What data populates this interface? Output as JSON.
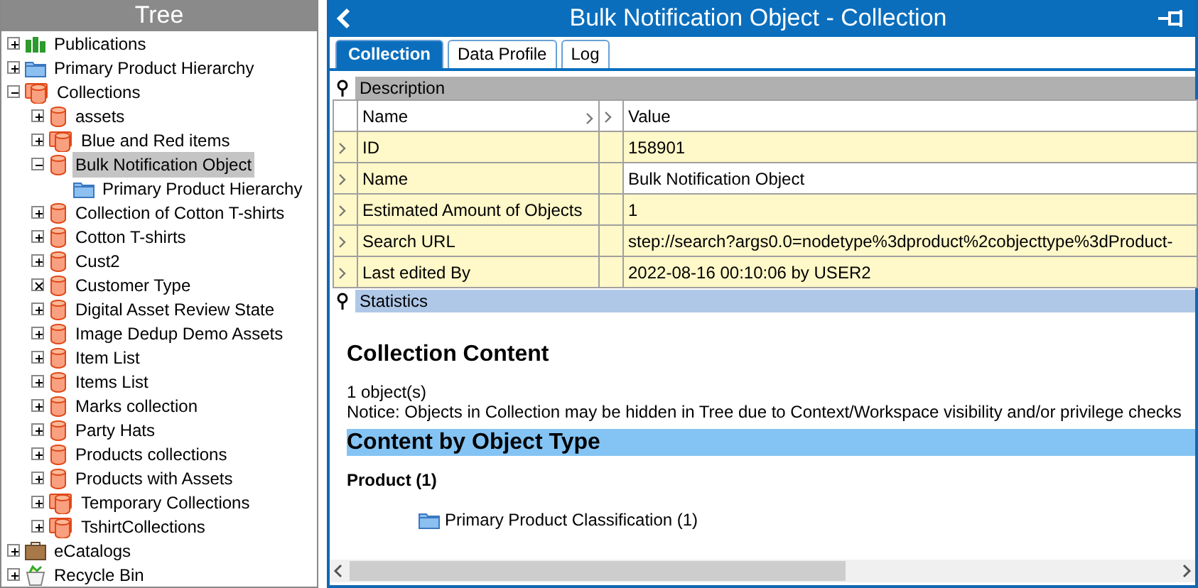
{
  "tree": {
    "title": "Tree",
    "items": [
      {
        "label": "Publications",
        "kind": "publication",
        "expanded": false,
        "empty": false,
        "selected": false
      },
      {
        "label": "Primary Product Hierarchy",
        "kind": "folder",
        "expanded": false,
        "empty": false,
        "selected": false
      },
      {
        "label": "Collections",
        "kind": "collection-group",
        "expanded": true,
        "empty": false,
        "selected": false,
        "children": [
          {
            "label": "assets",
            "kind": "collection",
            "expanded": false,
            "empty": false,
            "selected": false
          },
          {
            "label": "Blue and Red items",
            "kind": "collection-group",
            "expanded": false,
            "empty": false,
            "selected": false
          },
          {
            "label": "Bulk Notification Object",
            "kind": "collection",
            "expanded": true,
            "empty": false,
            "selected": true,
            "children": [
              {
                "label": "Primary Product Hierarchy",
                "kind": "folder",
                "selected": false
              }
            ]
          },
          {
            "label": "Collection of Cotton T-shirts",
            "kind": "collection",
            "expanded": false,
            "empty": false,
            "selected": false
          },
          {
            "label": "Cotton T-shirts",
            "kind": "collection",
            "expanded": false,
            "empty": false,
            "selected": false
          },
          {
            "label": "Cust2",
            "kind": "collection",
            "expanded": false,
            "empty": false,
            "selected": false
          },
          {
            "label": "Customer Type",
            "kind": "collection",
            "expanded": false,
            "empty": true,
            "selected": false
          },
          {
            "label": "Digital Asset Review State",
            "kind": "collection",
            "expanded": false,
            "empty": false,
            "selected": false
          },
          {
            "label": "Image Dedup Demo Assets",
            "kind": "collection",
            "expanded": false,
            "empty": false,
            "selected": false
          },
          {
            "label": "Item List",
            "kind": "collection",
            "expanded": false,
            "empty": false,
            "selected": false
          },
          {
            "label": "Items List",
            "kind": "collection",
            "expanded": false,
            "empty": false,
            "selected": false
          },
          {
            "label": "Marks collection",
            "kind": "collection",
            "expanded": false,
            "empty": false,
            "selected": false
          },
          {
            "label": "Party Hats",
            "kind": "collection",
            "expanded": false,
            "empty": false,
            "selected": false
          },
          {
            "label": "Products collections",
            "kind": "collection",
            "expanded": false,
            "empty": false,
            "selected": false
          },
          {
            "label": "Products with Assets",
            "kind": "collection",
            "expanded": false,
            "empty": false,
            "selected": false
          },
          {
            "label": "Temporary Collections",
            "kind": "collection-group",
            "expanded": false,
            "empty": false,
            "selected": false
          },
          {
            "label": "TshirtCollections",
            "kind": "collection-group",
            "expanded": false,
            "empty": false,
            "selected": false
          }
        ]
      },
      {
        "label": "eCatalogs",
        "kind": "catalog",
        "expanded": false,
        "empty": false,
        "selected": false
      },
      {
        "label": "Recycle Bin",
        "kind": "recycle",
        "expanded": false,
        "empty": false,
        "selected": false
      }
    ]
  },
  "editor": {
    "title": "Bulk Notification Object - Collection",
    "tabs": [
      {
        "label": "Collection",
        "selected": true
      },
      {
        "label": "Data Profile",
        "selected": false
      },
      {
        "label": "Log",
        "selected": false
      }
    ],
    "description": {
      "title": "Description",
      "columns": [
        "Name",
        "Value"
      ],
      "rows": [
        {
          "name": "ID",
          "value": "158901",
          "focused": false
        },
        {
          "name": "Name",
          "value": "Bulk Notification Object",
          "focused": true
        },
        {
          "name": "Estimated Amount of Objects",
          "value": "1",
          "focused": false
        },
        {
          "name": "Search URL",
          "value": "step://search?args0.0=nodetype%3dproduct%2cobjecttype%3dProduct-",
          "focused": false
        },
        {
          "name": "Last edited By",
          "value": "2022-08-16 00:10:06 by USER2",
          "focused": false
        }
      ]
    },
    "statistics": {
      "title": "Statistics",
      "heading": "Collection Content",
      "count": "1 object(s)",
      "notice": "Notice: Objects in Collection may be hidden in Tree due to Context/Workspace visibility and/or privilege checks",
      "section": "Content by Object Type",
      "groups": [
        {
          "type": "Product (1)",
          "entries": [
            {
              "label": "Primary Product Classification (1)",
              "kind": "folder"
            }
          ]
        }
      ]
    }
  }
}
